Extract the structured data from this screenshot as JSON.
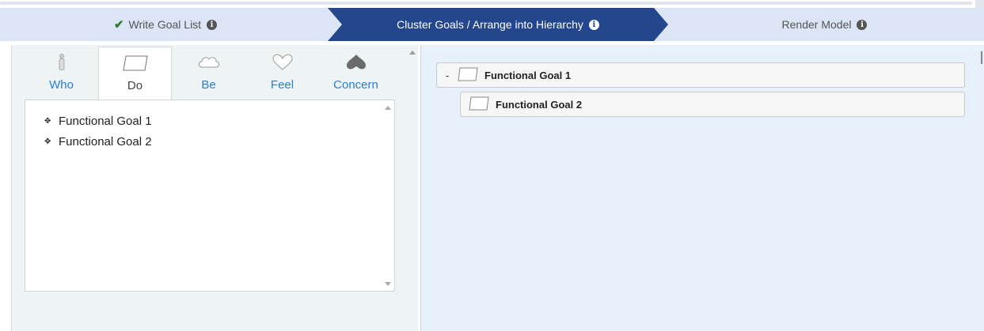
{
  "wizard": {
    "steps": [
      {
        "label": "Write Goal List",
        "state": "completed",
        "icon": "checkmark-icon"
      },
      {
        "label": "Cluster Goals / Arrange into Hierarchy",
        "state": "active"
      },
      {
        "label": "Render Model",
        "state": "pending"
      }
    ],
    "info_glyph": "i"
  },
  "tabs": [
    {
      "label": "Who",
      "icon": "person-icon"
    },
    {
      "label": "Do",
      "icon": "parallelogram-icon",
      "active": true
    },
    {
      "label": "Be",
      "icon": "cloud-icon"
    },
    {
      "label": "Feel",
      "icon": "heart-icon"
    },
    {
      "label": "Concern",
      "icon": "spade-icon"
    }
  ],
  "goal_list": {
    "items": [
      {
        "label": "Functional Goal 1"
      },
      {
        "label": "Functional Goal 2"
      }
    ]
  },
  "hierarchy": {
    "nodes": [
      {
        "label": "Functional Goal 1",
        "toggle": "-",
        "level": 0
      },
      {
        "label": "Functional Goal 2",
        "toggle": "",
        "level": 1
      }
    ]
  },
  "colors": {
    "active_step": "#23468d",
    "wizard_bg": "#dbe5f5",
    "tab_link": "#2a7dd1",
    "right_panel_bg": "#e7f1fb",
    "left_panel_bg": "#eef3f3",
    "check": "#2e7d32"
  }
}
